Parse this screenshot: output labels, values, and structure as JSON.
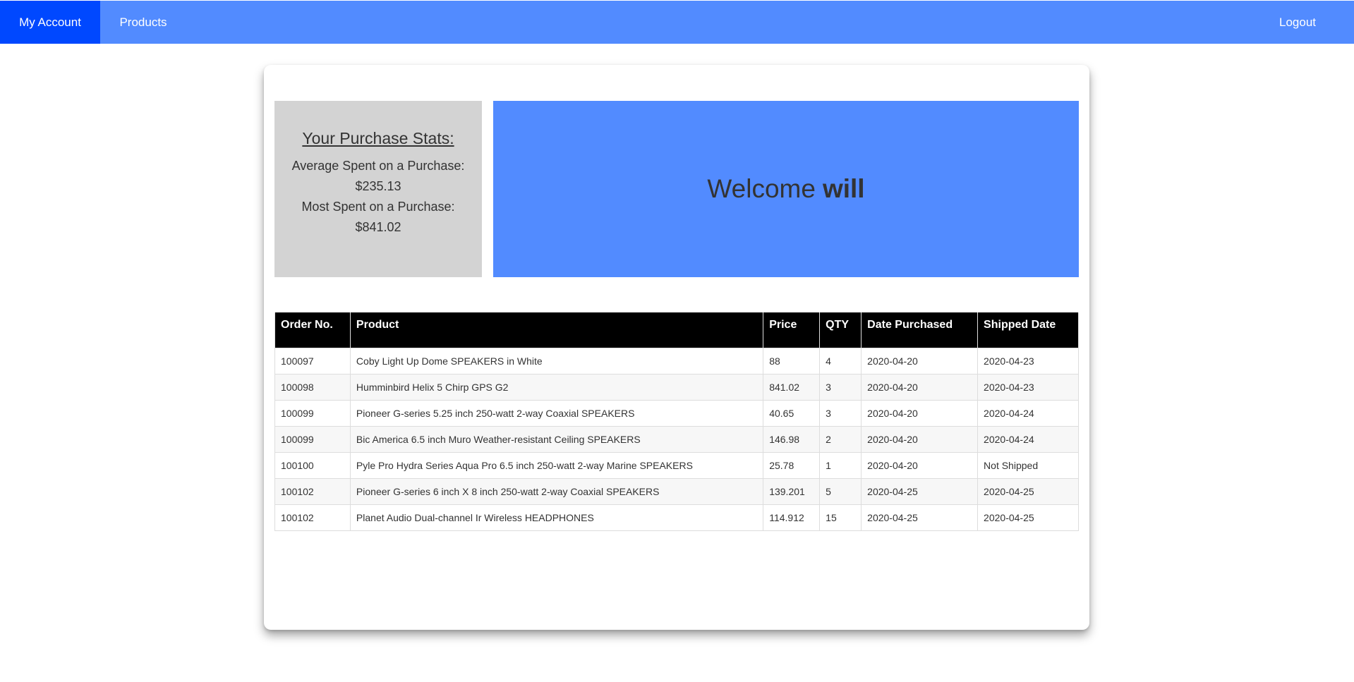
{
  "nav": {
    "account": "My Account",
    "products": "Products",
    "logout": "Logout"
  },
  "stats": {
    "title": "Your Purchase Stats:",
    "avg_label": "Average Spent on a Purchase:",
    "avg_value": "$235.13",
    "max_label": "Most Spent on a Purchase:",
    "max_value": "$841.02"
  },
  "welcome": {
    "greeting": "Welcome",
    "name": "will"
  },
  "table": {
    "headers": [
      "Order No.",
      "Product",
      "Price",
      "QTY",
      "Date Purchased",
      "Shipped Date"
    ],
    "rows": [
      [
        "100097",
        "Coby Light Up Dome SPEAKERS in White",
        "88",
        "4",
        "2020-04-20",
        "2020-04-23"
      ],
      [
        "100098",
        "Humminbird Helix 5 Chirp GPS G2",
        "841.02",
        "3",
        "2020-04-20",
        "2020-04-23"
      ],
      [
        "100099",
        "Pioneer G-series 5.25 inch 250-watt 2-way Coaxial SPEAKERS",
        "40.65",
        "3",
        "2020-04-20",
        "2020-04-24"
      ],
      [
        "100099",
        "Bic America 6.5 inch Muro Weather-resistant Ceiling SPEAKERS",
        "146.98",
        "2",
        "2020-04-20",
        "2020-04-24"
      ],
      [
        "100100",
        "Pyle Pro Hydra Series Aqua Pro 6.5 inch 250-watt 2-way Marine SPEAKERS",
        "25.78",
        "1",
        "2020-04-20",
        "Not Shipped"
      ],
      [
        "100102",
        "Pioneer G-series 6 inch X 8 inch 250-watt 2-way Coaxial SPEAKERS",
        "139.201",
        "5",
        "2020-04-25",
        "2020-04-25"
      ],
      [
        "100102",
        "Planet Audio Dual-channel Ir Wireless HEADPHONES",
        "114.912",
        "15",
        "2020-04-25",
        "2020-04-25"
      ]
    ]
  },
  "colors": {
    "nav_bg": "#528bff",
    "nav_active": "#0048ff",
    "stats_bg": "#d3d3d3",
    "welcome_bg": "#528bff",
    "table_header_bg": "#000000"
  }
}
